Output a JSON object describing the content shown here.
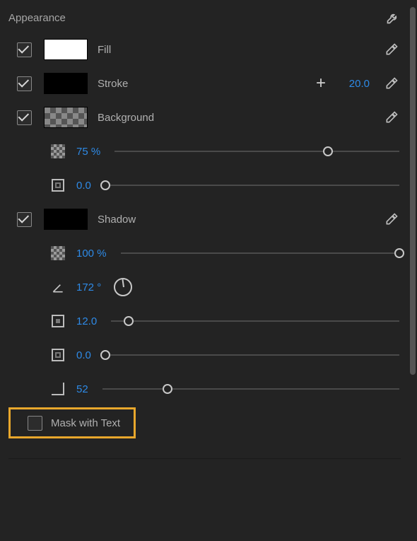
{
  "panel": {
    "title": "Appearance"
  },
  "fill": {
    "label": "Fill",
    "enabled": true,
    "color": "#ffffff"
  },
  "stroke": {
    "label": "Stroke",
    "enabled": true,
    "color": "#000000",
    "width": "20.0"
  },
  "background": {
    "label": "Background",
    "enabled": true,
    "opacity": {
      "value": "75",
      "unit": "%",
      "slider": 75
    },
    "size": {
      "value": "0.0",
      "slider": 0
    }
  },
  "shadow": {
    "label": "Shadow",
    "enabled": true,
    "color": "#000000",
    "opacity": {
      "value": "100",
      "unit": "%",
      "slider": 100
    },
    "angle": {
      "value": "172",
      "unit": "°"
    },
    "distance": {
      "value": "12.0",
      "slider": 6
    },
    "size": {
      "value": "0.0",
      "slider": 0
    },
    "blur": {
      "value": "52",
      "slider": 22
    }
  },
  "mask": {
    "label": "Mask with Text",
    "checked": false
  }
}
